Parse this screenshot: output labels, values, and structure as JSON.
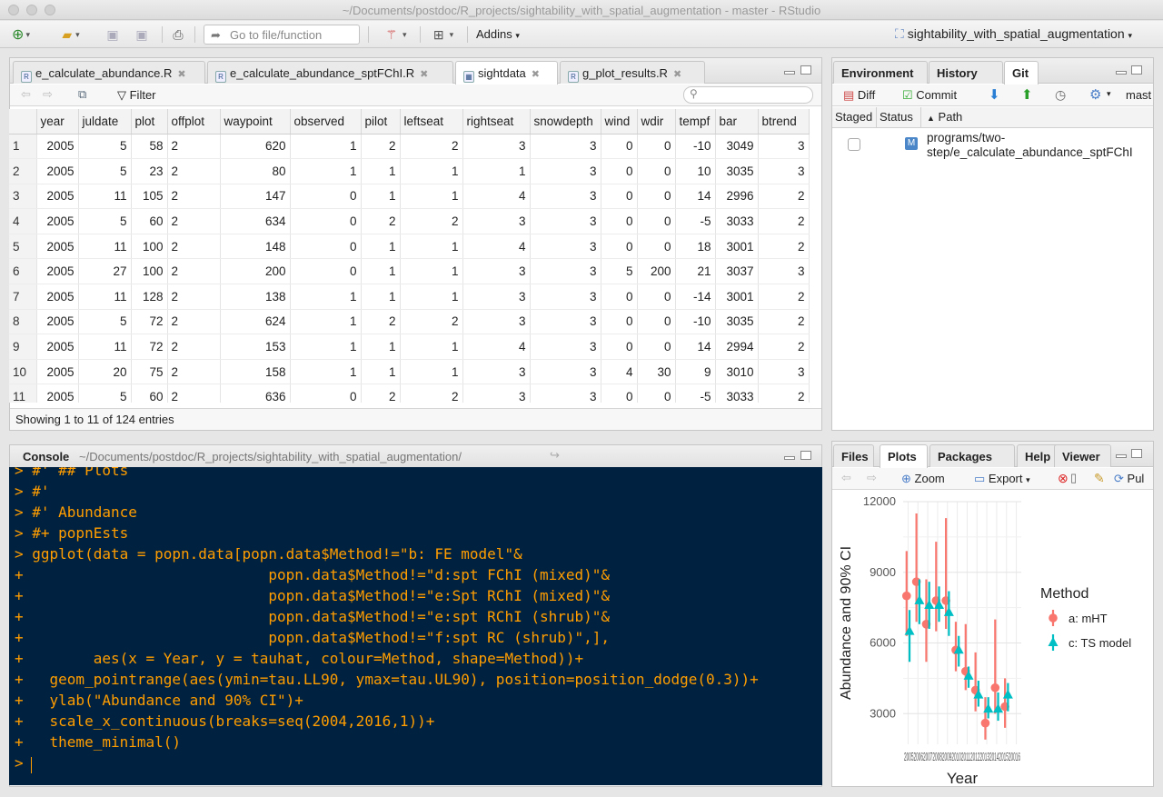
{
  "window": {
    "title": "~/Documents/postdoc/R_projects/sightability_with_spatial_augmentation - master - RStudio"
  },
  "toolbar": {
    "goto_placeholder": "Go to file/function",
    "addins_label": "Addins",
    "project_label": "sightability_with_spatial_augmentation"
  },
  "source_pane": {
    "tabs": [
      {
        "label": "e_calculate_abundance.R"
      },
      {
        "label": "e_calculate_abundance_sptFChI.R"
      },
      {
        "label": "sightdata"
      },
      {
        "label": "g_plot_results.R"
      }
    ],
    "filter_label": "Filter",
    "footer": "Showing 1 to 11 of 124 entries",
    "columns": [
      "year",
      "juldate",
      "plot",
      "offplot",
      "waypoint",
      "observed",
      "pilot",
      "leftseat",
      "rightseat",
      "snowdepth",
      "wind",
      "wdir",
      "tempf",
      "bar",
      "btrend"
    ],
    "rows": [
      [
        "1",
        "2005",
        "5",
        "58",
        "2",
        "620",
        "1",
        "2",
        "2",
        "3",
        "3",
        "0",
        "0",
        "-10",
        "3049",
        "3"
      ],
      [
        "2",
        "2005",
        "5",
        "23",
        "2",
        "80",
        "1",
        "1",
        "1",
        "1",
        "3",
        "0",
        "0",
        "10",
        "3035",
        "3"
      ],
      [
        "3",
        "2005",
        "11",
        "105",
        "2",
        "147",
        "0",
        "1",
        "1",
        "4",
        "3",
        "0",
        "0",
        "14",
        "2996",
        "2"
      ],
      [
        "4",
        "2005",
        "5",
        "60",
        "2",
        "634",
        "0",
        "2",
        "2",
        "3",
        "3",
        "0",
        "0",
        "-5",
        "3033",
        "2"
      ],
      [
        "5",
        "2005",
        "11",
        "100",
        "2",
        "148",
        "0",
        "1",
        "1",
        "4",
        "3",
        "0",
        "0",
        "18",
        "3001",
        "2"
      ],
      [
        "6",
        "2005",
        "27",
        "100",
        "2",
        "200",
        "0",
        "1",
        "1",
        "3",
        "3",
        "5",
        "200",
        "21",
        "3037",
        "3"
      ],
      [
        "7",
        "2005",
        "11",
        "128",
        "2",
        "138",
        "1",
        "1",
        "1",
        "3",
        "3",
        "0",
        "0",
        "-14",
        "3001",
        "2"
      ],
      [
        "8",
        "2005",
        "5",
        "72",
        "2",
        "624",
        "1",
        "2",
        "2",
        "3",
        "3",
        "0",
        "0",
        "-10",
        "3035",
        "2"
      ],
      [
        "9",
        "2005",
        "11",
        "72",
        "2",
        "153",
        "1",
        "1",
        "1",
        "4",
        "3",
        "0",
        "0",
        "14",
        "2994",
        "2"
      ],
      [
        "10",
        "2005",
        "20",
        "75",
        "2",
        "158",
        "1",
        "1",
        "1",
        "3",
        "3",
        "4",
        "30",
        "9",
        "3010",
        "3"
      ],
      [
        "11",
        "2005",
        "5",
        "60",
        "2",
        "636",
        "0",
        "2",
        "2",
        "3",
        "3",
        "0",
        "0",
        "-5",
        "3033",
        "2"
      ]
    ]
  },
  "console": {
    "title": "Console",
    "path": "~/Documents/postdoc/R_projects/sightability_with_spatial_augmentation/",
    "lines": [
      "> #' ## Plots",
      "> #'",
      "> #' Abundance",
      "> #+ popnEsts",
      "> ggplot(data = popn.data[popn.data$Method!=\"b: FE model\"&",
      "+                            popn.data$Method!=\"d:spt FChI (mixed)\"&",
      "+                            popn.data$Method!=\"e:Spt RChI (mixed)\"&",
      "+                            popn.data$Method!=\"e:spt RChI (shrub)\"&",
      "+                            popn.data$Method!=\"f:spt RC (shrub)\",],",
      "+        aes(x = Year, y = tauhat, colour=Method, shape=Method))+",
      "+   geom_pointrange(aes(ymin=tau.LL90, ymax=tau.UL90), position=position_dodge(0.3))+",
      "+   ylab(\"Abundance and 90% CI\")+",
      "+   scale_x_continuous(breaks=seq(2004,2016,1))+",
      "+   theme_minimal()",
      ">"
    ]
  },
  "env_pane": {
    "tabs": [
      "Environment",
      "History",
      "Git"
    ],
    "diff_label": "Diff",
    "commit_label": "Commit",
    "branch_label": "mast",
    "col_staged": "Staged",
    "col_status": "Status",
    "col_path": "Path",
    "file_status": "M",
    "file_path_1": "programs/two-",
    "file_path_2": "step/e_calculate_abundance_sptFChI"
  },
  "files_pane": {
    "tabs": [
      "Files",
      "Plots",
      "Packages",
      "Help",
      "Viewer"
    ],
    "zoom_label": "Zoom",
    "export_label": "Export",
    "publish_label": "Pul"
  },
  "chart_data": {
    "type": "scatter",
    "title": "",
    "xlabel": "Year",
    "ylabel": "Abundance and 90% CI",
    "xlim": [
      2004.5,
      2016.5
    ],
    "ylim": [
      1700,
      12000
    ],
    "yticks": [
      3000,
      6000,
      9000,
      12000
    ],
    "xtick_label_text": "2005200620072008200920102011201220132014201520016",
    "legend_title": "Method",
    "legend_position": "right",
    "series": [
      {
        "name": "a: mHT",
        "color": "#f8766d",
        "shape": "circle",
        "x": [
          2005,
          2006,
          2007,
          2008,
          2009,
          2010,
          2011,
          2012,
          2013,
          2014,
          2015
        ],
        "y": [
          8000,
          8600,
          6800,
          7800,
          7800,
          5700,
          4800,
          4000,
          2600,
          4100,
          3300
        ],
        "low": [
          6300,
          6900,
          5200,
          6500,
          6600,
          4800,
          4000,
          3100,
          1900,
          3000,
          2400
        ],
        "high": [
          9900,
          11500,
          8700,
          10300,
          11300,
          6900,
          6800,
          5600,
          3700,
          7000,
          4500
        ]
      },
      {
        "name": "c: TS model",
        "color": "#00bfc4",
        "shape": "triangle",
        "x": [
          2005,
          2006,
          2007,
          2008,
          2009,
          2010,
          2011,
          2012,
          2013,
          2014,
          2015
        ],
        "y": [
          6500,
          7800,
          7600,
          7600,
          7300,
          5700,
          4600,
          3800,
          3200,
          3200,
          3800
        ],
        "low": [
          5200,
          6800,
          6600,
          6900,
          6300,
          5000,
          4100,
          3300,
          2800,
          2700,
          3100
        ],
        "high": [
          7400,
          8700,
          8600,
          8400,
          8200,
          6300,
          5000,
          4400,
          3700,
          3900,
          4300
        ]
      }
    ]
  }
}
